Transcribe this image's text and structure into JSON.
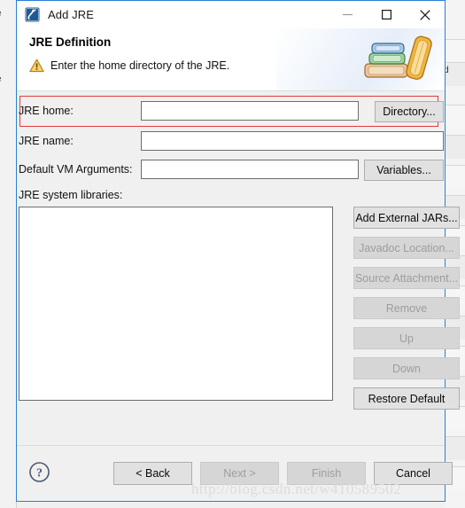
{
  "window": {
    "title": "Add JRE",
    "icon": "jre-app-icon",
    "controls": {
      "minimize": "minimize-icon",
      "maximize": "maximize-icon",
      "close": "close-icon"
    }
  },
  "header": {
    "title": "JRE Definition",
    "message": "Enter the home directory of the JRE.",
    "message_icon": "warning-triangle-icon",
    "art": "stack-of-books-image"
  },
  "form": {
    "rows": [
      {
        "label": "JRE home:",
        "value": "",
        "placeholder": "",
        "button": {
          "label": "Directory...",
          "enabled": true
        }
      },
      {
        "label": "JRE name:",
        "value": "",
        "placeholder": "",
        "button": null
      },
      {
        "label": "Default VM Arguments:",
        "value": "",
        "placeholder": "",
        "button": {
          "label": "Variables...",
          "enabled": true
        }
      }
    ],
    "highlight_color": "#e03a3a"
  },
  "libraries": {
    "label": "JRE system libraries:",
    "items": [],
    "buttons": [
      {
        "label": "Add External JARs...",
        "enabled": true
      },
      {
        "label": "Javadoc Location...",
        "enabled": false
      },
      {
        "label": "Source Attachment...",
        "enabled": false
      },
      {
        "label": "Remove",
        "enabled": false
      },
      {
        "label": "Up",
        "enabled": false
      },
      {
        "label": "Down",
        "enabled": false
      },
      {
        "label": "Restore Default",
        "enabled": true
      }
    ]
  },
  "footer": {
    "help_icon": "help-question-icon",
    "buttons": [
      {
        "label": "< Back",
        "enabled": true
      },
      {
        "label": "Next >",
        "enabled": false
      },
      {
        "label": "Finish",
        "enabled": false
      },
      {
        "label": "Cancel",
        "enabled": true
      }
    ],
    "watermark": "http://blog.csdn.net/w410589502"
  },
  "background": {
    "left_fragments": [
      "e",
      "t",
      "e"
    ],
    "right_fragments": [
      "d"
    ]
  }
}
